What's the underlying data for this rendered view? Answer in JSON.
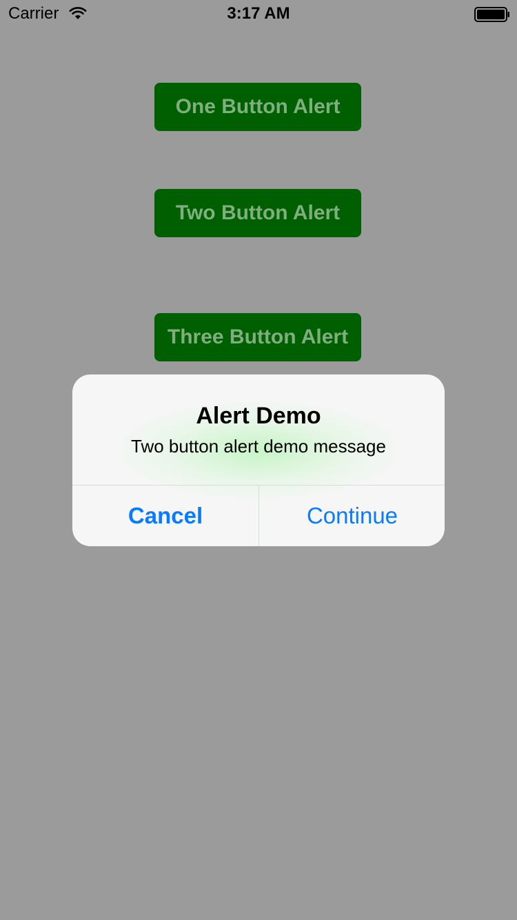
{
  "status_bar": {
    "carrier": "Carrier",
    "time": "3:17 AM",
    "icons": [
      "wifi-icon",
      "battery-icon"
    ]
  },
  "buttons": {
    "one": "One Button Alert",
    "two": "Two Button Alert",
    "three": "Three Button Alert"
  },
  "alert": {
    "title": "Alert Demo",
    "message": "Two button alert demo message",
    "cancel": "Cancel",
    "continue": "Continue"
  },
  "colors": {
    "background": "#9b9b9b",
    "button_background": "#005f00",
    "button_text": "#7fae7f",
    "alert_action": "#0a7aff"
  }
}
